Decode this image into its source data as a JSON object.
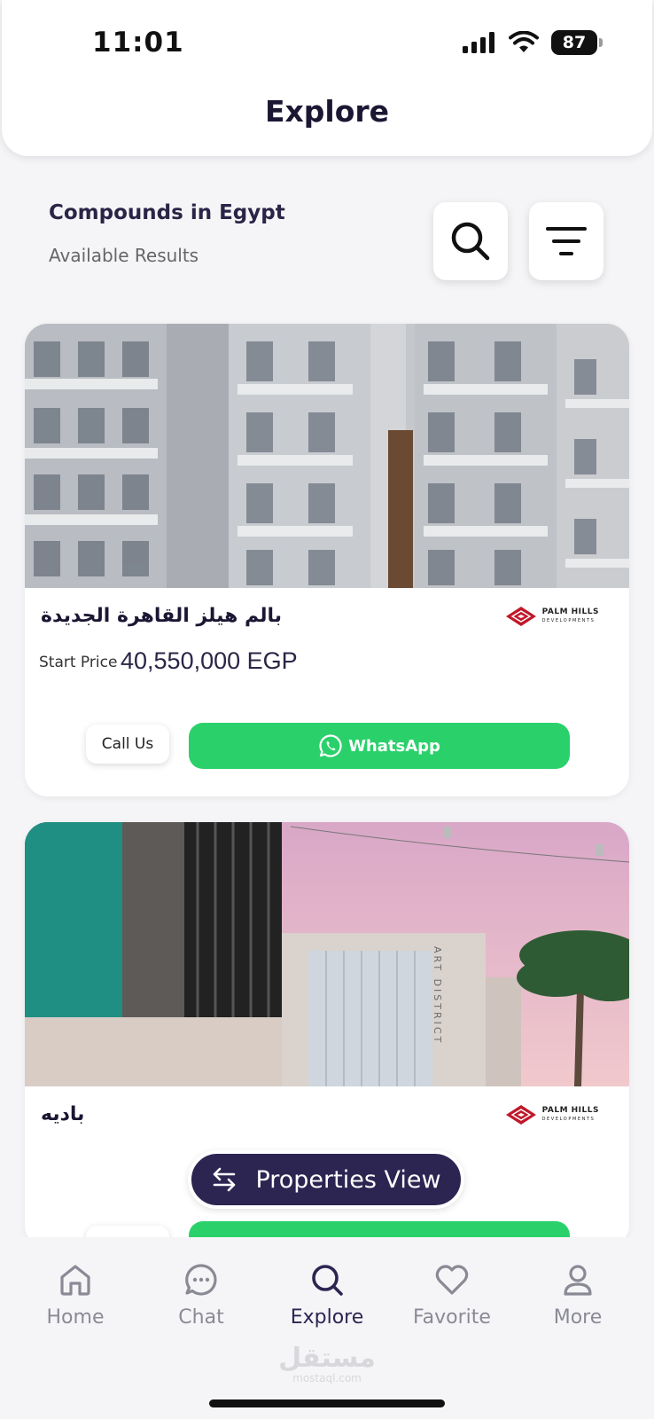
{
  "status_bar": {
    "time": "11:01",
    "battery": "87"
  },
  "header": {
    "title": "Explore"
  },
  "section": {
    "title": "Compounds in Egypt",
    "subtitle": "Available Results"
  },
  "listings": [
    {
      "name": "بالم هيلز القاهرة الجديدة",
      "developer": {
        "name": "PALM HILLS",
        "tagline": "DEVELOPMENTS"
      },
      "price_label": "Start Price",
      "price": "40,550,000 EGP",
      "call_label": "Call Us",
      "whatsapp_label": "WhatsApp"
    },
    {
      "name": "باديه",
      "developer": {
        "name": "PALM HILLS",
        "tagline": "DEVELOPMENTS"
      },
      "artwork_text": "ART DISTRICT"
    }
  ],
  "floating_button": {
    "label": "Properties View"
  },
  "bottom_nav": {
    "items": [
      {
        "label": "Home",
        "icon": "home-icon"
      },
      {
        "label": "Chat",
        "icon": "chat-icon"
      },
      {
        "label": "Explore",
        "icon": "search-icon",
        "active": true
      },
      {
        "label": "Favorite",
        "icon": "heart-icon"
      },
      {
        "label": "More",
        "icon": "user-icon"
      }
    ]
  },
  "watermark": {
    "arabic": "مستقل",
    "latin": "mostaql.com"
  },
  "colors": {
    "primary": "#2c2552",
    "whatsapp": "#2ad16a",
    "background": "#f5f5f7",
    "brand_red": "#c0182a"
  }
}
